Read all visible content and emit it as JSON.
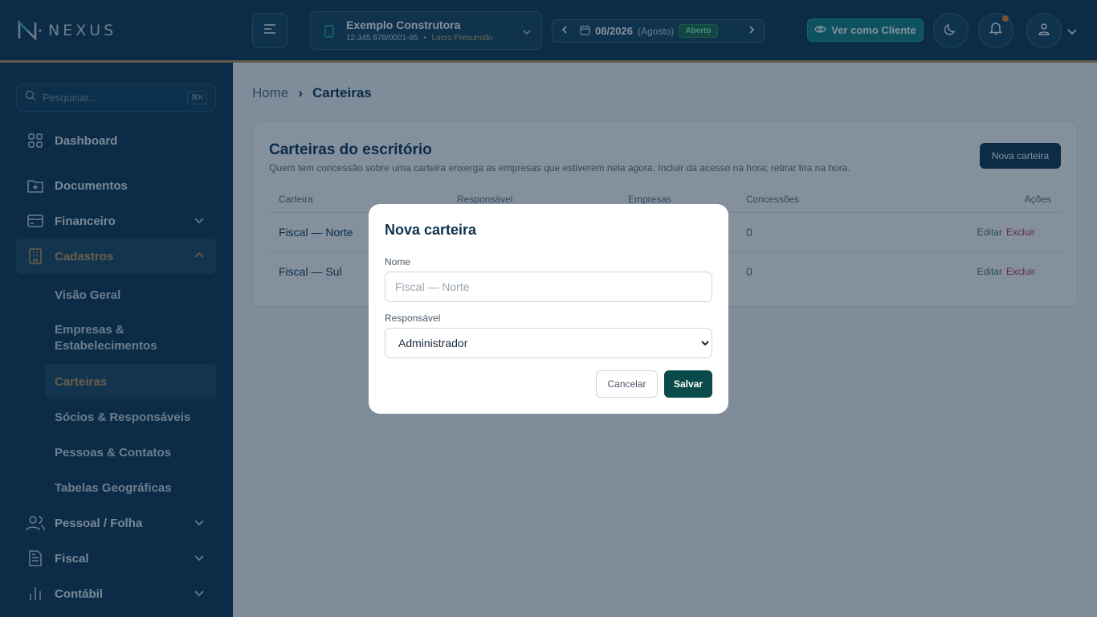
{
  "brand": {
    "name": "NEXUS"
  },
  "search": {
    "placeholder": "Pesquisar...",
    "shortcut": "⌘K"
  },
  "sidebar": {
    "items": [
      {
        "label": "Dashboard",
        "icon": "grid-icon"
      },
      {
        "label": "Documentos",
        "icon": "folder-plus-icon"
      },
      {
        "label": "Financeiro",
        "icon": "wallet-icon"
      },
      {
        "label": "Cadastros",
        "icon": "building-icon"
      },
      {
        "label": "Pessoal / Folha",
        "icon": "users-icon"
      },
      {
        "label": "Fiscal",
        "icon": "file-text-icon"
      },
      {
        "label": "Contábil",
        "icon": "bar-chart-icon"
      }
    ],
    "cadastros_sub": [
      {
        "label": "Visão Geral"
      },
      {
        "label": "Empresas & Estabelecimentos"
      },
      {
        "label": "Carteiras"
      },
      {
        "label": "Sócios & Responsáveis"
      },
      {
        "label": "Pessoas & Contatos"
      },
      {
        "label": "Tabelas Geográficas"
      }
    ]
  },
  "topbar": {
    "company_name": "Exemplo Construtora",
    "company_cnpj": "12.345.678/0001-95",
    "company_regime": "Lucro Presumido",
    "period_date": "08/2026",
    "period_month": "(Agosto)",
    "period_status": "Aberto",
    "view_client_label": "Ver como Cliente"
  },
  "breadcrumb": {
    "home": "Home",
    "current": "Carteiras"
  },
  "card": {
    "title": "Carteiras do escritório",
    "subtitle": "Quem tem concessão sobre uma carteira enxerga as empresas que estiverem nela agora. Incluir dá acesso na hora; retirar tira na hora.",
    "new_button": "Nova carteira",
    "columns": [
      "Carteira",
      "Responsável",
      "Empresas",
      "Concessões",
      "Ações"
    ],
    "rows": [
      {
        "name": "Fiscal — Norte",
        "grants": "0",
        "edit": "Editar",
        "delete": "Excluir"
      },
      {
        "name": "Fiscal — Sul",
        "grants": "0",
        "edit": "Editar",
        "delete": "Excluir"
      }
    ]
  },
  "modal": {
    "title": "Nova carteira",
    "name_label": "Nome",
    "name_placeholder": "Fiscal — Norte",
    "owner_label": "Responsável",
    "owner_selected": "Administrador",
    "cancel_label": "Cancelar",
    "save_label": "Salvar"
  },
  "colors": {
    "navy": "#0c3350",
    "gold": "#c49a5c",
    "teal": "#137f83",
    "danger": "#c0304a"
  }
}
